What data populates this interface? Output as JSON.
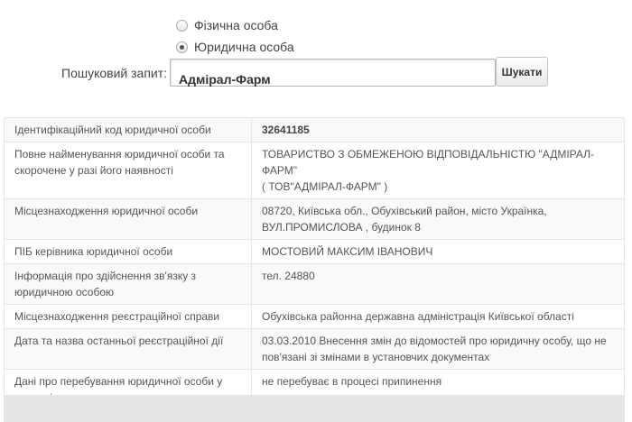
{
  "search_form": {
    "radio_person": {
      "label": "Фізична особа",
      "checked": false
    },
    "radio_entity": {
      "label": "Юридична особа",
      "checked": true
    },
    "query_label": "Пошуковий запит:",
    "query_value": "Адмірал-Фарм",
    "submit_label": "Шукати"
  },
  "result_table": {
    "rows": [
      {
        "label": "Ідентифікаційний код юридичної особи",
        "value": "32641185",
        "bold": true
      },
      {
        "label": "Повне найменування юридичної особи та скорочене у разі його наявності",
        "value": "ТОВАРИСТВО З ОБМЕЖЕНОЮ ВІДПОВІДАЛЬНІСТЮ \"АДМІРАЛ-ФАРМ\"",
        "value_line2": "( ТОВ\"АДМІРАЛ-ФАРМ\" )"
      },
      {
        "label": "Місцезнаходження юридичної особи",
        "value": "08720, Київська обл., Обухівський район, місто Українка, ВУЛ.ПРОМИСЛОВА , будинок 8"
      },
      {
        "label": "ПІБ керівника юридичної особи",
        "value": "МОСТОВИЙ МАКСИМ ІВАНОВИЧ"
      },
      {
        "label": "Інформація про здійснення зв'язку з юридичною особою",
        "value": "тел. 24880"
      },
      {
        "label": "Місцезнаходження реєстраційної справи",
        "value": "Обухівська районна державна адміністрація Київської області"
      },
      {
        "label": "Дата та назва останньої реєстраційної дії",
        "value": "03.03.2010 Внесення змін до відомостей про юридичну особу, що не пов'язані зі змінами в установчих документах"
      },
      {
        "label": "Дані про перебування юридичної особи у процесі припинення",
        "value": "не перебуває в процесі припинення"
      }
    ]
  }
}
